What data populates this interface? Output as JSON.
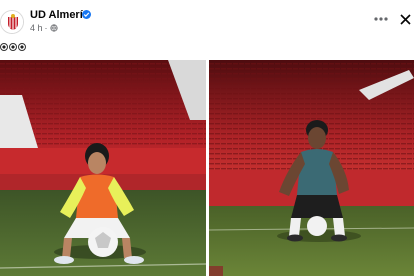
{
  "post": {
    "page_name": "UD Almería",
    "time": "4 h",
    "caption_icons": [
      "soccer-ball-icon",
      "soccer-ball-icon",
      "soccer-ball-icon"
    ]
  },
  "icons": {
    "verified": "verified-badge-icon",
    "audience": "globe-icon",
    "more": "more-options-icon",
    "close": "close-icon"
  },
  "colors": {
    "verified_blue": "#1877f2",
    "meta_gray": "#65676b",
    "stadium_red": "#c4262a",
    "pitch_green": "#4f6b2e"
  }
}
